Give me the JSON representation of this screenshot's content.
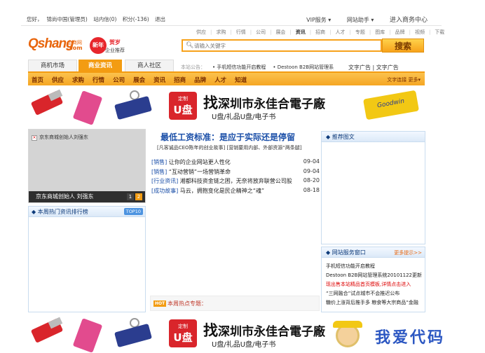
{
  "topbar": {
    "greeting": "您好，",
    "user": "锦尚中国(管理员)",
    "messages": "站内信(0)",
    "points": "积分(-136)",
    "logout": "退出",
    "vip": "VIP服务 ▾",
    "assistant": "网站助手 ▾",
    "business_center": "进入商务中心"
  },
  "logo": {
    "brand": "Qshang",
    "suffix": ".com",
    "cn": "企商网"
  },
  "badge": {
    "circle": "新年",
    "line1": "贺岁",
    "line2": "企业推荐"
  },
  "catnav": [
    "供应",
    "求购",
    "行情",
    "公司",
    "展会",
    "资讯",
    "招商",
    "人才",
    "专题",
    "图库",
    "品牌",
    "视频",
    "下载"
  ],
  "catnav_active": "资讯",
  "search": {
    "placeholder": "请输入关键字",
    "button": "搜索"
  },
  "tabs": [
    {
      "label": "商机市场",
      "active": false
    },
    {
      "label": "商业资讯",
      "active": true
    },
    {
      "label": "商人社区",
      "active": false
    }
  ],
  "notice": {
    "label": "本站公告：",
    "item1": "• 手机短信功能开启教程",
    "item2": "• Destoon B2B网站管理系"
  },
  "adlinks": "文字广告 | 文字广告",
  "mainnav": [
    "首页",
    "供应",
    "求购",
    "行情",
    "公司",
    "展会",
    "资讯",
    "招商",
    "品牌",
    "人才",
    "知道"
  ],
  "mainnav_more": "文字连接  更多▾",
  "banner": {
    "badge_top": "定制",
    "badge_main": "U盘",
    "lead": "找",
    "company": "深圳市永佳合電子廠",
    "subtitle": "U盘/礼品U盘/电子书",
    "usb_brand": "Goodwin"
  },
  "focus": {
    "title": "京东商城创始人刘强东",
    "caption": "京东商城创始人 刘强东",
    "pages": [
      "1",
      "2"
    ]
  },
  "rank": {
    "title": "本周热门资讯排行榜",
    "tag": "TOP10"
  },
  "headline": "最低工资标准：是应于实际还是停留",
  "subline": "[凡客诚品CEO陈年的创业故事] [营销要用内部、外部资源“两条腿]",
  "news": [
    {
      "cat": "[销售]",
      "title": " 让你的企业网站更人性化",
      "date": "09-04"
    },
    {
      "cat": "[销售]",
      "title": " “互动营销”一场营销革命",
      "date": "09-04"
    },
    {
      "cat": "[行业资讯]",
      "title": " 湘都科技资金链之困，无奈将放弃联营公司股",
      "date": "08-20"
    },
    {
      "cat": "[成功故事]",
      "title": " 马云，拥抱变化是民企精神之“魂”",
      "date": "08-18"
    }
  ],
  "hot": {
    "tag": "HOT",
    "label": "本周热点专题："
  },
  "picbox": {
    "title": "推荐图文"
  },
  "service": {
    "title": "网站服务窗口",
    "more": "更多提示>>",
    "items": [
      {
        "text": "手机短信功能开启教程",
        "red": false
      },
      {
        "text": "Destoon B2B网站管理系统20101122更新",
        "red": false
      },
      {
        "text": "现出售本站精品首页模板,详情点击进入",
        "red": true
      },
      {
        "text": "“三网融合”试点城市不会推迟公布",
        "red": false
      },
      {
        "text": "糖价上涨背后推手多 粮食等大宗商品“金融",
        "red": false
      }
    ]
  },
  "watermark": "我爱代码"
}
